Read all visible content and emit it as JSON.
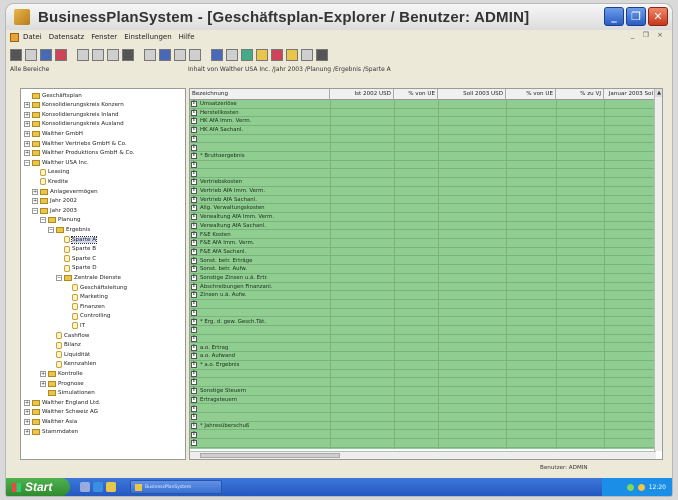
{
  "window": {
    "title": "BusinessPlanSystem - [Geschäftsplan-Explorer / Benutzer: ADMIN]",
    "controls": [
      "_",
      "❐",
      "✕"
    ]
  },
  "menu": [
    "Datei",
    "Datensatz",
    "Fenster",
    "Einstellungen",
    "Hilfe"
  ],
  "menu_mdi": "_ ❐ ×",
  "left_panel_label": "Alle Bereiche",
  "right_panel_label": "Inhalt von Walther USA Inc. /Jahr 2003 /Planung /Ergebnis /Sparte A",
  "tree": [
    {
      "label": "Geschäftsplan",
      "level": 0,
      "exp": "",
      "sel": false
    },
    {
      "label": "Konsolidierungskreis Konzern",
      "level": 0,
      "exp": "+",
      "sel": false
    },
    {
      "label": "Konsolidierungskreis Inland",
      "level": 0,
      "exp": "+",
      "sel": false
    },
    {
      "label": "Konsolidierungskreis Ausland",
      "level": 0,
      "exp": "+",
      "sel": false
    },
    {
      "label": "Walther GmbH",
      "level": 0,
      "exp": "+",
      "sel": false
    },
    {
      "label": "Walther Vertriebs GmbH & Co.",
      "level": 0,
      "exp": "+",
      "sel": false
    },
    {
      "label": "Walther Produktions GmbH & Co.",
      "level": 0,
      "exp": "+",
      "sel": false
    },
    {
      "label": "Walther USA Inc.",
      "level": 0,
      "exp": "−",
      "sel": false
    },
    {
      "label": "Leasing",
      "level": 1,
      "exp": "",
      "sel": false,
      "leaf": true
    },
    {
      "label": "Kredite",
      "level": 1,
      "exp": "",
      "sel": false,
      "leaf": true
    },
    {
      "label": "Anlagevermögen",
      "level": 1,
      "exp": "+",
      "sel": false
    },
    {
      "label": "Jahr 2002",
      "level": 1,
      "exp": "+",
      "sel": false
    },
    {
      "label": "Jahr 2003",
      "level": 1,
      "exp": "−",
      "sel": false
    },
    {
      "label": "Planung",
      "level": 2,
      "exp": "−",
      "sel": false
    },
    {
      "label": "Ergebnis",
      "level": 3,
      "exp": "−",
      "sel": false
    },
    {
      "label": "Sparte A",
      "level": 4,
      "exp": "",
      "sel": true,
      "leaf": true
    },
    {
      "label": "Sparte B",
      "level": 4,
      "exp": "",
      "sel": false,
      "leaf": true
    },
    {
      "label": "Sparte C",
      "level": 4,
      "exp": "",
      "sel": false,
      "leaf": true
    },
    {
      "label": "Sparte D",
      "level": 4,
      "exp": "",
      "sel": false,
      "leaf": true
    },
    {
      "label": "Zentrale Dienste",
      "level": 4,
      "exp": "−",
      "sel": false
    },
    {
      "label": "Geschäftsleitung",
      "level": 5,
      "exp": "",
      "sel": false,
      "leaf": true
    },
    {
      "label": "Marketing",
      "level": 5,
      "exp": "",
      "sel": false,
      "leaf": true
    },
    {
      "label": "Finanzen",
      "level": 5,
      "exp": "",
      "sel": false,
      "leaf": true
    },
    {
      "label": "Controlling",
      "level": 5,
      "exp": "",
      "sel": false,
      "leaf": true
    },
    {
      "label": "IT",
      "level": 5,
      "exp": "",
      "sel": false,
      "leaf": true
    },
    {
      "label": "Cashflow",
      "level": 3,
      "exp": "",
      "sel": false,
      "leaf": true
    },
    {
      "label": "Bilanz",
      "level": 3,
      "exp": "",
      "sel": false,
      "leaf": true
    },
    {
      "label": "Liquidität",
      "level": 3,
      "exp": "",
      "sel": false,
      "leaf": true
    },
    {
      "label": "Kennzahlen",
      "level": 3,
      "exp": "",
      "sel": false,
      "leaf": true
    },
    {
      "label": "Kontrolle",
      "level": 2,
      "exp": "+",
      "sel": false
    },
    {
      "label": "Prognose",
      "level": 2,
      "exp": "+",
      "sel": false
    },
    {
      "label": "Simulationen",
      "level": 2,
      "exp": "",
      "sel": false
    },
    {
      "label": "Walther England Ltd.",
      "level": 0,
      "exp": "+",
      "sel": false
    },
    {
      "label": "Walther Schweiz AG",
      "level": 0,
      "exp": "+",
      "sel": false
    },
    {
      "label": "Walther Asia",
      "level": 0,
      "exp": "+",
      "sel": false
    },
    {
      "label": "Stammdaten",
      "level": 0,
      "exp": "+",
      "sel": false
    }
  ],
  "grid": {
    "columns": [
      "Bezeichnung",
      "Ist 2002 USD",
      "% von UE",
      "Soll 2003 USD",
      "% von UE",
      "% zu VJ",
      "Januar 2003 Sol"
    ],
    "rows": [
      "Umsatzerlöse",
      "Herstellkosten",
      "HK AfA Imm. Verm.",
      "HK AfA Sachanl.",
      "",
      "",
      "* Bruttoergebnis",
      "",
      "",
      "Vertriebskosten",
      "Vertrieb AfA Imm. Verm.",
      "Vertrieb AfA Sachanl.",
      "Allg. Verwaltungskosten",
      "Verwaltung AfA Imm. Verm.",
      "Verwaltung AfA Sachanl.",
      "F&E Kosten",
      "F&E AfA Imm. Verm.",
      "F&E AfA Sachanl.",
      "Sonst. betr. Erträge",
      "Sonst. betr. Aufw.",
      "Sonstige Zinsen u.ä. Ertr.",
      "Abschreibungen Finanzanl.",
      "Zinsen u.ä. Aufw.",
      "",
      "",
      "* Erg. d. gew. Gesch.Tät.",
      "",
      "",
      "a.o. Ertrag",
      "a.o. Aufwand",
      "* a.o. Ergebnis",
      "",
      "",
      "Sonstige Steuern",
      "Ertragsteuern",
      "",
      "",
      "* Jahresüberschuß",
      "",
      ""
    ]
  },
  "status": {
    "user": "Benutzer: ADMIN"
  },
  "taskbar": {
    "start": "Start",
    "task": "BusinessPlanSystem",
    "clock": "12:20"
  }
}
